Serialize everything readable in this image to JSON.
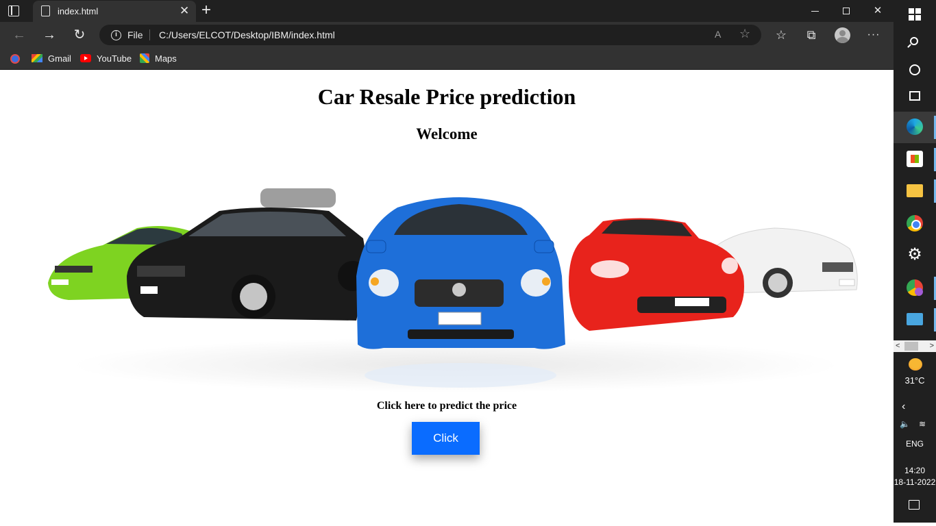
{
  "browser": {
    "tab": {
      "title": "index.html"
    },
    "address": {
      "scheme_label": "File",
      "url": "C:/Users/ELCOT/Desktop/IBM/index.html"
    },
    "bookmarks": [
      {
        "label": "Gmail",
        "icon": "gmail-icon"
      },
      {
        "label": "YouTube",
        "icon": "youtube-icon"
      },
      {
        "label": "Maps",
        "icon": "maps-icon"
      }
    ]
  },
  "page": {
    "title": "Car Resale Price prediction",
    "welcome": "Welcome",
    "prompt": "Click here to predict the price",
    "button_label": "Click",
    "button_color": "#0a6cff"
  },
  "taskbar": {
    "temperature": "31°C",
    "language": "ENG",
    "time": "14:20",
    "date": "18-11-2022"
  }
}
